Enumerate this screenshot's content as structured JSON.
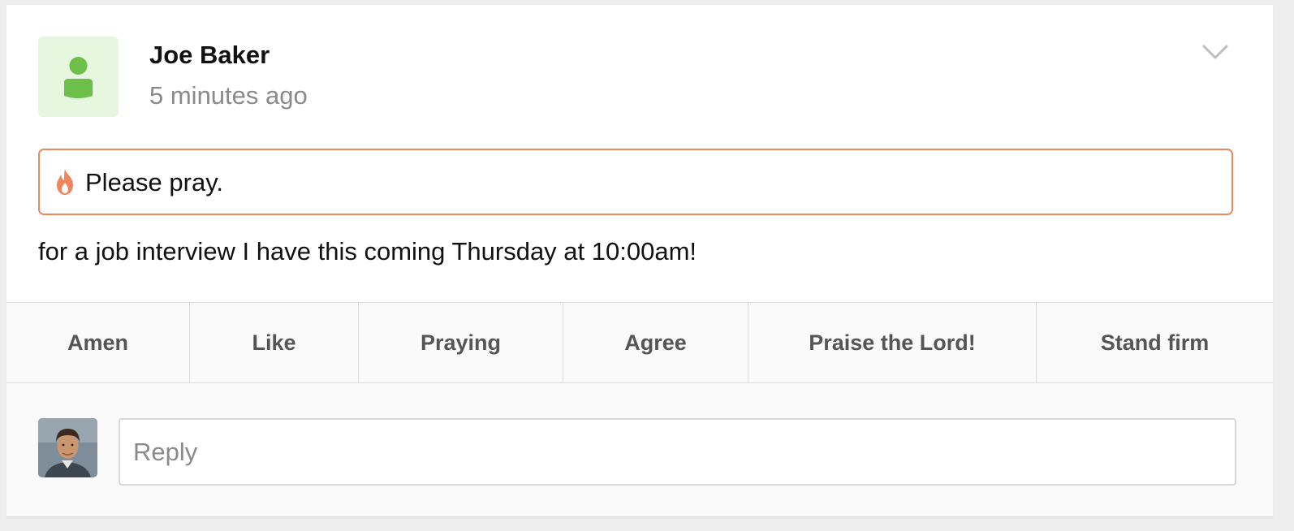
{
  "post": {
    "author": "Joe Baker",
    "timestamp": "5 minutes ago",
    "author_avatar_icon": "user-icon",
    "menu_icon": "chevron-down-icon",
    "prayer_request": {
      "icon": "flame-icon",
      "title": "Please pray."
    },
    "body": "for a job interview I have this coming Thursday at 10:00am!"
  },
  "reactions": [
    {
      "label": "Amen"
    },
    {
      "label": "Like"
    },
    {
      "label": "Praying"
    },
    {
      "label": "Agree"
    },
    {
      "label": "Praise the Lord!"
    },
    {
      "label": "Stand firm"
    }
  ],
  "reply": {
    "placeholder": "Reply",
    "value": ""
  },
  "colors": {
    "accent_orange": "#f0865e",
    "avatar_green": "#6cc04a",
    "avatar_bg": "#e6f6df",
    "muted_text": "#8a8a8a"
  }
}
